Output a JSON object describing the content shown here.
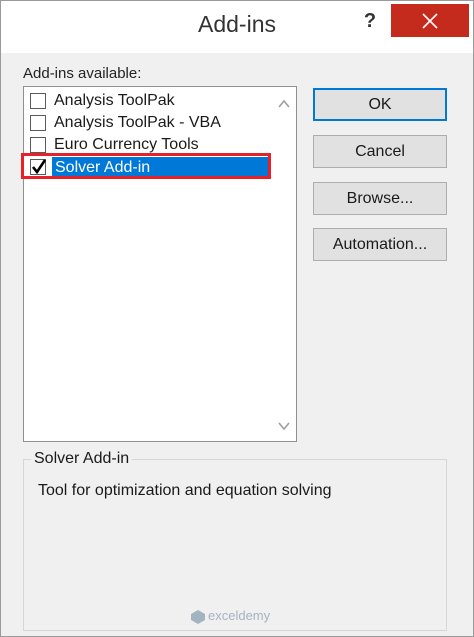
{
  "window": {
    "title": "Add-ins",
    "help_label": "?"
  },
  "addins": {
    "label": "Add-ins available:",
    "items": [
      {
        "label": "Analysis ToolPak",
        "checked": false,
        "selected": false
      },
      {
        "label": "Analysis ToolPak - VBA",
        "checked": false,
        "selected": false
      },
      {
        "label": "Euro Currency Tools",
        "checked": false,
        "selected": false
      },
      {
        "label": "Solver Add-in",
        "checked": true,
        "selected": true
      }
    ]
  },
  "buttons": {
    "ok": "OK",
    "cancel": "Cancel",
    "browse": "Browse...",
    "automation": "Automation..."
  },
  "description": {
    "title": "Solver Add-in",
    "text": "Tool for optimization and equation solving"
  },
  "watermark": {
    "text": "exceldemy"
  },
  "colors": {
    "selection": "#0078d7",
    "highlight_box": "#e8202a",
    "close_button": "#c42b1c"
  }
}
